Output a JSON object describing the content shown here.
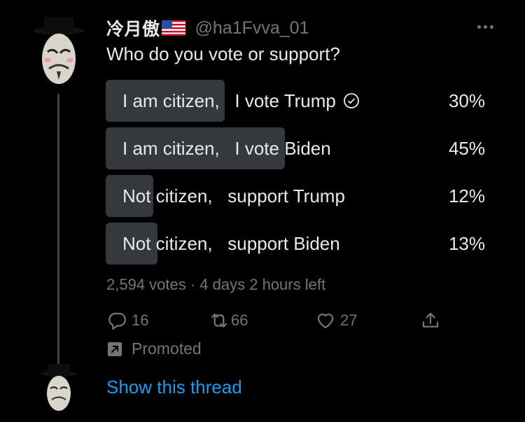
{
  "header": {
    "display_name": "冷月傲",
    "handle": "@ha1Fvva_01"
  },
  "tweet": {
    "text": "Who do you vote or support?"
  },
  "poll": {
    "options": [
      {
        "label": "I am citizen,   I vote Trump",
        "percent": "30%",
        "fraction": 0.3,
        "selected": true
      },
      {
        "label": "I am citizen,   I vote Biden",
        "percent": "45%",
        "fraction": 0.45,
        "selected": false
      },
      {
        "label": "Not citizen,   support Trump",
        "percent": "12%",
        "fraction": 0.12,
        "selected": false
      },
      {
        "label": "Not citizen,   support Biden",
        "percent": "13%",
        "fraction": 0.13,
        "selected": false
      }
    ],
    "meta": "2,594 votes · 4 days 2 hours left"
  },
  "actions": {
    "replies": "16",
    "retweets": "66",
    "likes": "27"
  },
  "promoted": {
    "label": "Promoted"
  },
  "thread": {
    "link": "Show this thread"
  },
  "colors": {
    "background": "#000000",
    "text": "#e7e9ea",
    "muted": "#71767b",
    "poll_bar": "#35393d",
    "link": "#1d9bf0"
  },
  "icons": [
    "more-icon",
    "check-icon",
    "reply-icon",
    "retweet-icon",
    "like-icon",
    "share-icon",
    "promoted-icon",
    "us-flag-icon"
  ]
}
